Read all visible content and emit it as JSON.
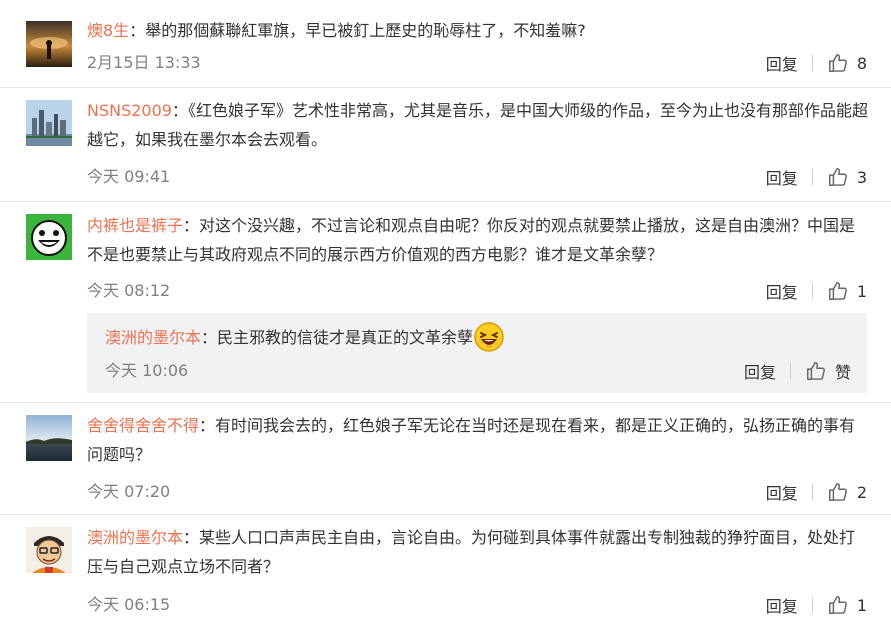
{
  "ui": {
    "reply_label": "回复",
    "like_label": "赞",
    "separator": "："
  },
  "comments": [
    {
      "user": "燠8生",
      "text": "舉的那個蘇聯紅軍旗，早已被釘上歷史的恥辱柱了，不知羞嘛?",
      "time": "2月15日 13:33",
      "likes": "8"
    },
    {
      "user": "NSNS2009",
      "text": "《红色娘子军》艺术性非常高，尤其是音乐，是中国大师级的作品，至今为止也没有那部作品能超越它，如果我在墨尔本会去观看。",
      "time": "今天 09:41",
      "likes": "3"
    },
    {
      "user": "内裤也是裤子",
      "text": "对这个没兴趣，不过言论和观点自由呢？你反对的观点就要禁止播放，这是自由澳洲？中国是不是也要禁止与其政府观点不同的展示西方价值观的西方电影？谁才是文革余孽？",
      "time": "今天 08:12",
      "likes": "1",
      "reply": {
        "user": "澳洲的墨尔本",
        "text": "民主邪教的信徒才是真正的文革余孽",
        "emoji": "laughing-emoji",
        "time": "今天 10:06"
      }
    },
    {
      "user": "舍舍得舍舍不得",
      "text": "有时间我会去的，红色娘子军无论在当时还是现在看来，都是正义正确的，弘扬正确的事有问题吗？",
      "time": "今天 07:20",
      "likes": "2"
    },
    {
      "user": "澳洲的墨尔本",
      "text": "某些人口口声声民主自由，言论自由。为何碰到具体事件就露出专制独裁的狰狞面目，处处打压与自己观点立场不同者？",
      "time": "今天 06:15",
      "likes": "1"
    }
  ],
  "colors": {
    "username": "#eb7350",
    "meta": "#808080",
    "reply_bg": "#f2f2f5"
  }
}
